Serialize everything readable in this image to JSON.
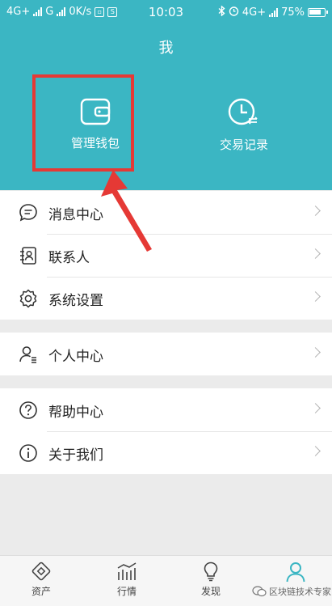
{
  "status_bar": {
    "network1": "4G+",
    "network2": "G",
    "speed": "0K/s",
    "time": "10:03",
    "network3": "4G+",
    "battery_text": "75%"
  },
  "page": {
    "title": "我"
  },
  "header_actions": {
    "wallet_label": "管理钱包",
    "transactions_label": "交易记录"
  },
  "menu_groups": [
    {
      "items": [
        {
          "label": "消息中心",
          "icon": "message-icon"
        },
        {
          "label": "联系人",
          "icon": "contacts-icon"
        },
        {
          "label": "系统设置",
          "icon": "settings-gear-icon"
        }
      ]
    },
    {
      "items": [
        {
          "label": "个人中心",
          "icon": "person-icon"
        }
      ]
    },
    {
      "items": [
        {
          "label": "帮助中心",
          "icon": "help-icon"
        },
        {
          "label": "关于我们",
          "icon": "info-icon"
        }
      ]
    }
  ],
  "tab_bar": {
    "tabs": [
      {
        "label": "资产",
        "icon": "assets-icon"
      },
      {
        "label": "行情",
        "icon": "market-chart-icon"
      },
      {
        "label": "发现",
        "icon": "discover-bulb-icon"
      },
      {
        "label": "",
        "icon": "me-person-icon",
        "active": true
      }
    ]
  },
  "watermark": {
    "text": "区块链技术专家"
  },
  "colors": {
    "primary": "#3bb6c3",
    "highlight": "#e53935",
    "background": "#ebebeb"
  }
}
